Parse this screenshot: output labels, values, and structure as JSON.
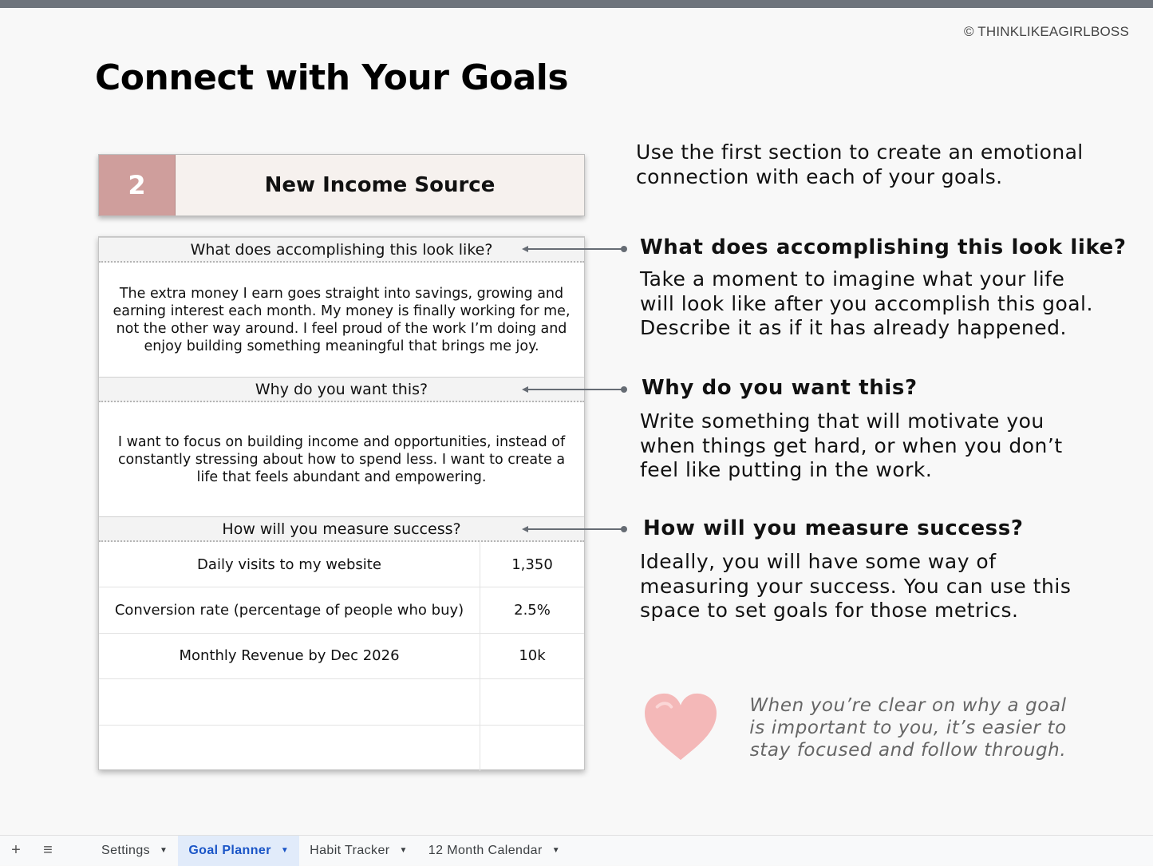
{
  "copyright": "© THINKLIKEAGIRLBOSS",
  "page_title": "Connect with Your Goals",
  "goal": {
    "number": "2",
    "name": "New Income Source"
  },
  "sheet": {
    "q1": "What does accomplishing this look like?",
    "a1": "The extra money I earn goes straight into savings, growing and earning interest each month. My money is finally working for me, not the other way around. I feel proud of the work I’m doing and enjoy building something meaningful that brings me joy.",
    "q2": "Why do you want this?",
    "a2": "I want to focus on building income and opportunities, instead of constantly stressing about how to spend less. I want to create a life that feels abundant and empowering.",
    "q3": "How will you measure success?",
    "metrics": [
      {
        "label": "Daily visits to my website",
        "value": "1,350"
      },
      {
        "label": "Conversion rate (percentage of people who buy)",
        "value": "2.5%"
      },
      {
        "label": "Monthly Revenue by Dec 2026",
        "value": "10k"
      },
      {
        "label": "",
        "value": ""
      },
      {
        "label": "",
        "value": ""
      }
    ]
  },
  "guide": {
    "intro": "Use the first section to create an emotional connection with each of your goals.",
    "s1_title": "What does accomplishing this look like?",
    "s1_body": "Take a moment to imagine what your life will look like after you accomplish this goal. Describe it as if it has already happened.",
    "s2_title": "Why do you want this?",
    "s2_body": "Write something that will motivate you when things get hard, or when you don’t feel like putting in the work.",
    "s3_title": "How will you measure success?",
    "s3_body": "Ideally, you will have some way of measuring your success. You can use this space to set goals for those metrics.",
    "quote": "When you’re clear on why a goal is important to you, it’s easier to stay focused and follow through."
  },
  "tabs": [
    {
      "label": "Settings",
      "active": false
    },
    {
      "label": "Goal Planner",
      "active": true
    },
    {
      "label": "Habit Tracker",
      "active": false
    },
    {
      "label": "12 Month Calendar",
      "active": false
    }
  ],
  "colors": {
    "goal_number_bg": "#cf9e9c",
    "active_tab_bg": "#e1ebfa",
    "active_tab_text": "#1a55c7",
    "heart": "#f4b8b8"
  }
}
